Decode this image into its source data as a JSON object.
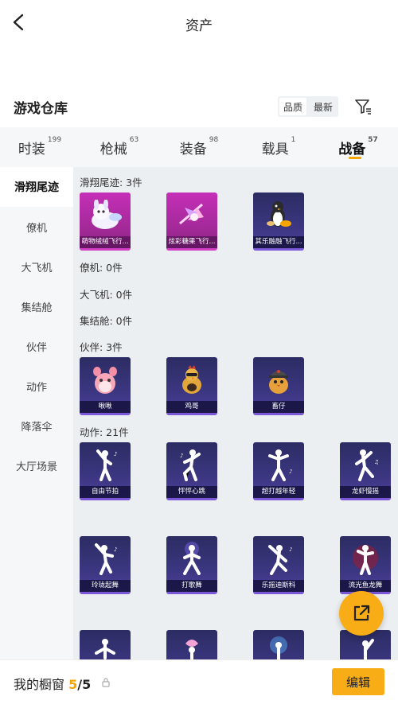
{
  "header": {
    "title": "资产"
  },
  "section": {
    "title": "游戏仓库",
    "sort_options": [
      "品质",
      "最新"
    ]
  },
  "tabs": [
    {
      "label": "时装",
      "count": "199"
    },
    {
      "label": "枪械",
      "count": "63"
    },
    {
      "label": "装备",
      "count": "98"
    },
    {
      "label": "载具",
      "count": "1"
    },
    {
      "label": "战备",
      "count": "57"
    }
  ],
  "sidebar": [
    "滑翔尾迹",
    "僚机",
    "大飞机",
    "集结舱",
    "伙伴",
    "动作",
    "降落伞",
    "大厅场景"
  ],
  "groups": {
    "glide": {
      "label": "滑翔尾迹: 3件",
      "items": [
        "萌物绒绒飞行...",
        "炫彩糖果飞行...",
        "其乐融融飞行..."
      ]
    },
    "wingman": {
      "label": "僚机: 0件"
    },
    "plane": {
      "label": "大飞机: 0件"
    },
    "pod": {
      "label": "集结舱: 0件"
    },
    "partner": {
      "label": "伙伴: 3件",
      "items": [
        "啾啾",
        "鸡哥",
        "畜仔"
      ]
    },
    "emote": {
      "label": "动作: 21件",
      "items": [
        "自由节拍",
        "怦怦心跳",
        "超打越年轻",
        "龙虾慢摇",
        "玲珑起舞",
        "打歌舞",
        "乐摇迪斯科",
        "流光鱼龙舞"
      ]
    }
  },
  "bottom": {
    "label": "我的橱窗",
    "current": "5",
    "total": "/5",
    "edit": "编辑"
  },
  "colors": {
    "accent": "#f8ad17",
    "card_purple": "#3b3680",
    "card_pink": "#c52fb8"
  }
}
